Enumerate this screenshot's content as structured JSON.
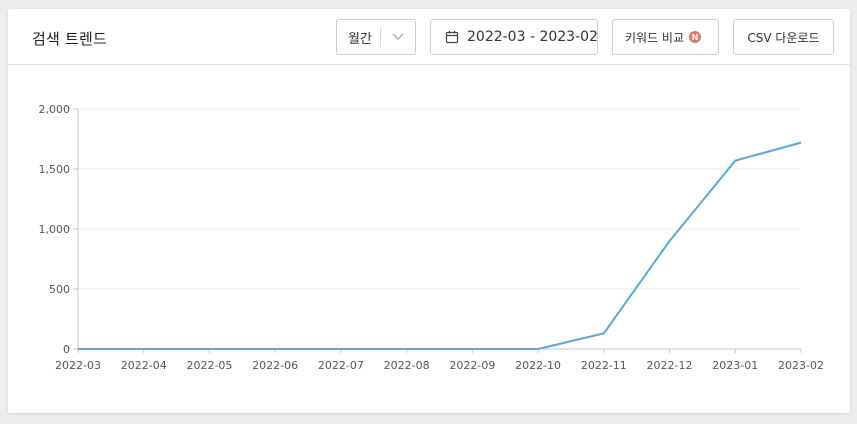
{
  "header": {
    "title": "검색 트렌드",
    "period_label": "월간",
    "date_range": "2022-03 - 2023-02",
    "compare_label": "키워드 비교",
    "compare_badge": "N",
    "csv_label": "CSV 다운로드"
  },
  "chart_data": {
    "type": "line",
    "categories": [
      "2022-03",
      "2022-04",
      "2022-05",
      "2022-06",
      "2022-07",
      "2022-08",
      "2022-09",
      "2022-10",
      "2022-11",
      "2022-12",
      "2023-01",
      "2023-02"
    ],
    "series": [
      {
        "values": [
          0,
          0,
          0,
          0,
          0,
          0,
          0,
          0,
          130,
          900,
          1570,
          1720
        ]
      }
    ],
    "y_ticks": [
      "0",
      "500",
      "1,000",
      "1,500",
      "2,000"
    ],
    "ylim": [
      0,
      2000
    ],
    "grid": true,
    "line_color": "#5ba8de"
  }
}
